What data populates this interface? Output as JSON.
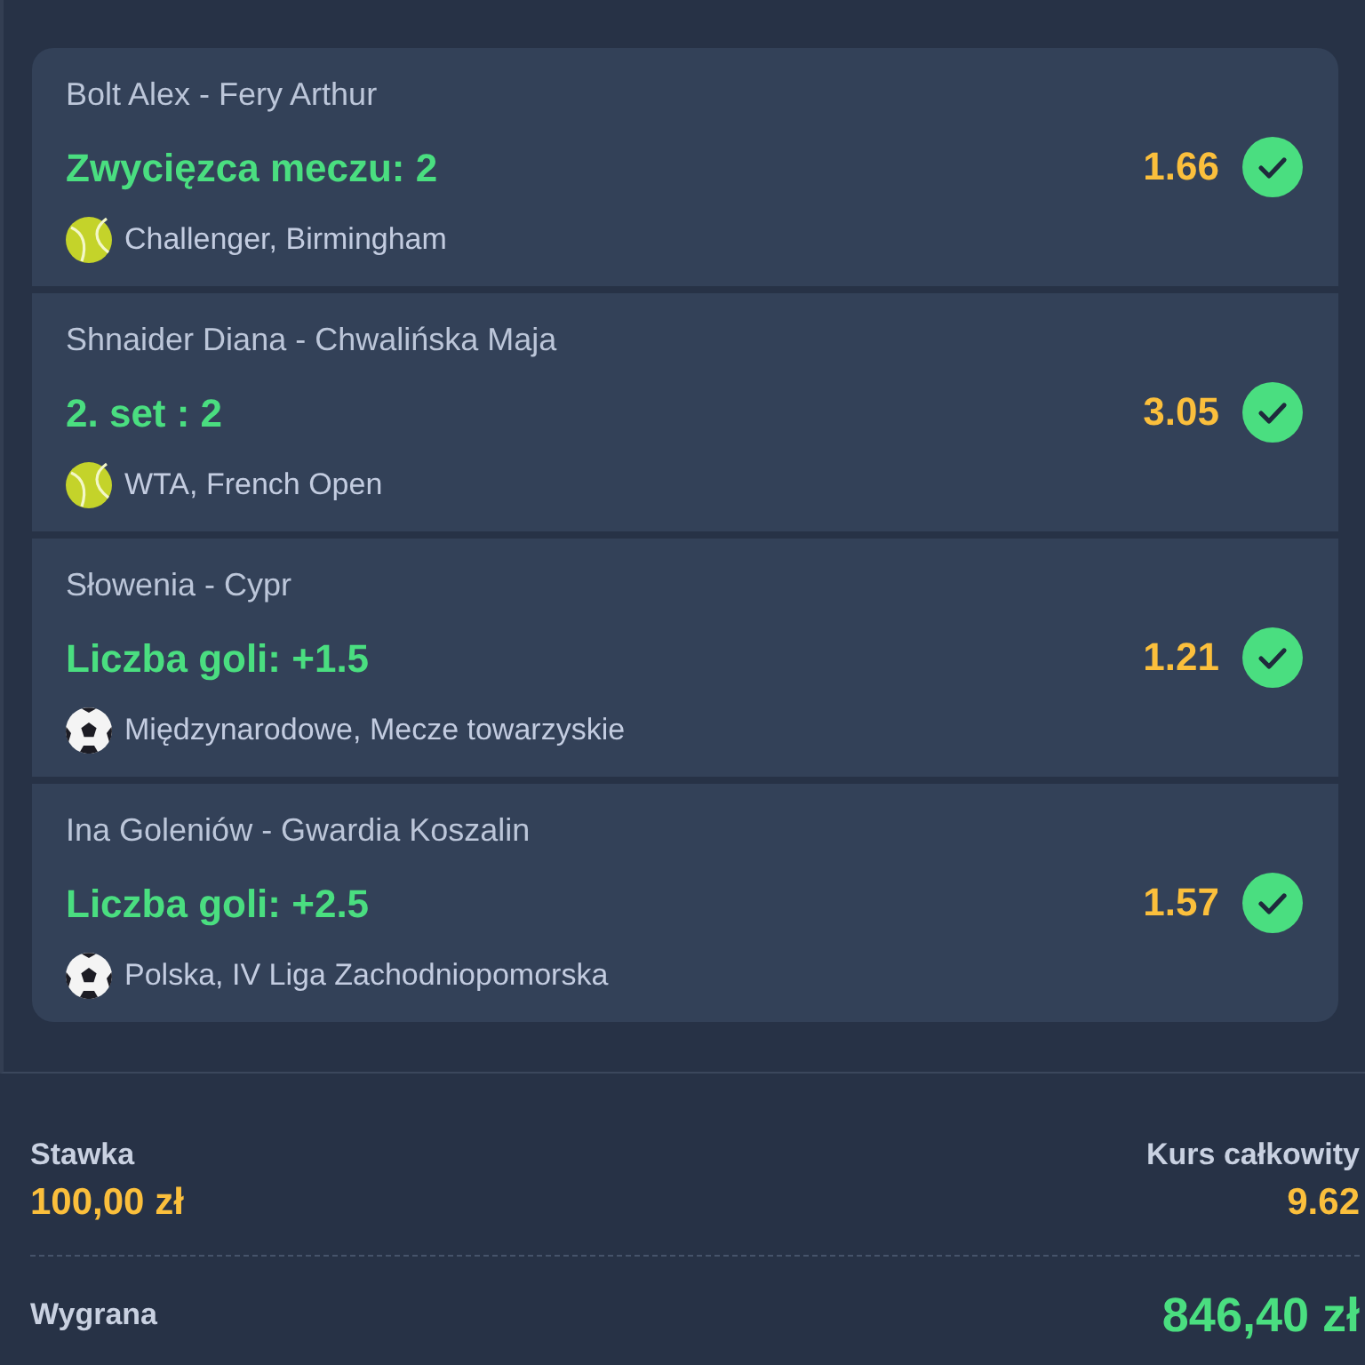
{
  "bets": [
    {
      "match": "Bolt Alex - Fery Arthur",
      "selection": "Zwycięzca meczu: 2",
      "odds": "1.66",
      "won": true,
      "kind": "tennis",
      "league": "Challenger, Birmingham"
    },
    {
      "match": "Shnaider Diana - Chwalińska Maja",
      "selection": "2. set : 2",
      "odds": "3.05",
      "won": true,
      "kind": "tennis",
      "league": "WTA, French Open"
    },
    {
      "match": "Słowenia - Cypr",
      "selection": "Liczba goli: +1.5",
      "odds": "1.21",
      "won": true,
      "kind": "football",
      "league": "Międzynarodowe, Mecze towarzyskie"
    },
    {
      "match": "Ina Goleniów - Gwardia Koszalin",
      "selection": "Liczba goli: +2.5",
      "odds": "1.57",
      "won": true,
      "kind": "football",
      "league": "Polska, IV Liga Zachodniopomorska"
    }
  ],
  "summary": {
    "stake_label": "Stawka",
    "stake": "100,00 zł",
    "total_odds_label": "Kurs całkowity",
    "total_odds": "9.62",
    "winnings_label": "Wygrana",
    "winnings": "846,40 zł"
  }
}
